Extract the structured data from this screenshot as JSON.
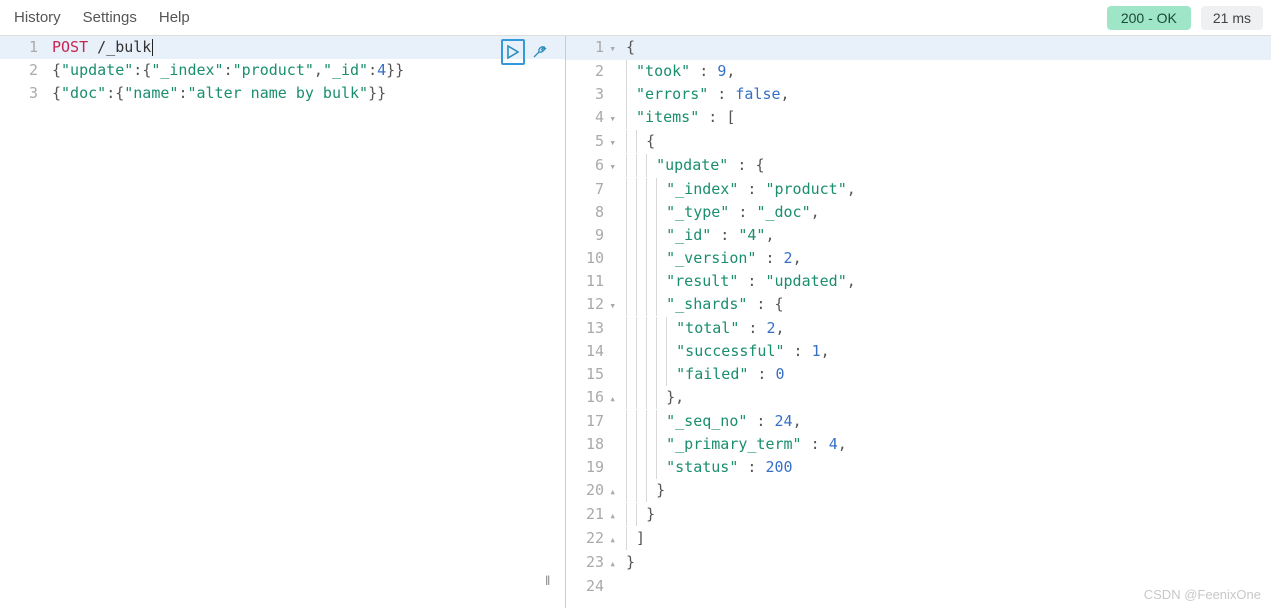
{
  "menu": {
    "history": "History",
    "settings": "Settings",
    "help": "Help"
  },
  "status": {
    "label": "200 - OK"
  },
  "time": {
    "label": "21 ms"
  },
  "watermark": "CSDN @FeenixOne",
  "request": {
    "lines": [
      {
        "n": 1,
        "method": "POST",
        "path": "/_bulk",
        "highlight": true,
        "cursor": true
      },
      {
        "n": 2,
        "raw": [
          [
            "{",
            "punc"
          ],
          [
            "\"update\"",
            "key"
          ],
          [
            ":",
            "punc"
          ],
          [
            "{",
            "punc"
          ],
          [
            "\"_index\"",
            "key"
          ],
          [
            ":",
            "punc"
          ],
          [
            "\"product\"",
            "str"
          ],
          [
            ",",
            "punc"
          ],
          [
            "\"_id\"",
            "key"
          ],
          [
            ":",
            "punc"
          ],
          [
            "4",
            "num"
          ],
          [
            "}}",
            "punc"
          ]
        ]
      },
      {
        "n": 3,
        "raw": [
          [
            "{",
            "punc"
          ],
          [
            "\"doc\"",
            "key"
          ],
          [
            ":",
            "punc"
          ],
          [
            "{",
            "punc"
          ],
          [
            "\"name\"",
            "key"
          ],
          [
            ":",
            "punc"
          ],
          [
            "\"alter name by bulk\"",
            "str"
          ],
          [
            "}}",
            "punc"
          ]
        ]
      }
    ]
  },
  "response": {
    "lines": [
      {
        "n": 1,
        "indent": 0,
        "fold": "▾",
        "highlight": true,
        "raw": [
          [
            "{",
            "punc"
          ]
        ]
      },
      {
        "n": 2,
        "indent": 1,
        "raw": [
          [
            "\"took\"",
            "key"
          ],
          [
            " : ",
            "punc"
          ],
          [
            "9",
            "num"
          ],
          [
            ",",
            "punc"
          ]
        ]
      },
      {
        "n": 3,
        "indent": 1,
        "raw": [
          [
            "\"errors\"",
            "key"
          ],
          [
            " : ",
            "punc"
          ],
          [
            "false",
            "bool"
          ],
          [
            ",",
            "punc"
          ]
        ]
      },
      {
        "n": 4,
        "indent": 1,
        "fold": "▾",
        "raw": [
          [
            "\"items\"",
            "key"
          ],
          [
            " : ",
            "punc"
          ],
          [
            "[",
            "punc"
          ]
        ]
      },
      {
        "n": 5,
        "indent": 2,
        "fold": "▾",
        "raw": [
          [
            "{",
            "punc"
          ]
        ]
      },
      {
        "n": 6,
        "indent": 3,
        "fold": "▾",
        "raw": [
          [
            "\"update\"",
            "key"
          ],
          [
            " : ",
            "punc"
          ],
          [
            "{",
            "punc"
          ]
        ]
      },
      {
        "n": 7,
        "indent": 4,
        "raw": [
          [
            "\"_index\"",
            "key"
          ],
          [
            " : ",
            "punc"
          ],
          [
            "\"product\"",
            "str"
          ],
          [
            ",",
            "punc"
          ]
        ]
      },
      {
        "n": 8,
        "indent": 4,
        "raw": [
          [
            "\"_type\"",
            "key"
          ],
          [
            " : ",
            "punc"
          ],
          [
            "\"_doc\"",
            "str"
          ],
          [
            ",",
            "punc"
          ]
        ]
      },
      {
        "n": 9,
        "indent": 4,
        "raw": [
          [
            "\"_id\"",
            "key"
          ],
          [
            " : ",
            "punc"
          ],
          [
            "\"4\"",
            "str"
          ],
          [
            ",",
            "punc"
          ]
        ]
      },
      {
        "n": 10,
        "indent": 4,
        "raw": [
          [
            "\"_version\"",
            "key"
          ],
          [
            " : ",
            "punc"
          ],
          [
            "2",
            "num"
          ],
          [
            ",",
            "punc"
          ]
        ]
      },
      {
        "n": 11,
        "indent": 4,
        "raw": [
          [
            "\"result\"",
            "key"
          ],
          [
            " : ",
            "punc"
          ],
          [
            "\"updated\"",
            "str"
          ],
          [
            ",",
            "punc"
          ]
        ]
      },
      {
        "n": 12,
        "indent": 4,
        "fold": "▾",
        "raw": [
          [
            "\"_shards\"",
            "key"
          ],
          [
            " : ",
            "punc"
          ],
          [
            "{",
            "punc"
          ]
        ]
      },
      {
        "n": 13,
        "indent": 5,
        "raw": [
          [
            "\"total\"",
            "key"
          ],
          [
            " : ",
            "punc"
          ],
          [
            "2",
            "num"
          ],
          [
            ",",
            "punc"
          ]
        ]
      },
      {
        "n": 14,
        "indent": 5,
        "raw": [
          [
            "\"successful\"",
            "key"
          ],
          [
            " : ",
            "punc"
          ],
          [
            "1",
            "num"
          ],
          [
            ",",
            "punc"
          ]
        ]
      },
      {
        "n": 15,
        "indent": 5,
        "raw": [
          [
            "\"failed\"",
            "key"
          ],
          [
            " : ",
            "punc"
          ],
          [
            "0",
            "num"
          ]
        ]
      },
      {
        "n": 16,
        "indent": 4,
        "fold": "▴",
        "raw": [
          [
            "},",
            "punc"
          ]
        ]
      },
      {
        "n": 17,
        "indent": 4,
        "raw": [
          [
            "\"_seq_no\"",
            "key"
          ],
          [
            " : ",
            "punc"
          ],
          [
            "24",
            "num"
          ],
          [
            ",",
            "punc"
          ]
        ]
      },
      {
        "n": 18,
        "indent": 4,
        "raw": [
          [
            "\"_primary_term\"",
            "key"
          ],
          [
            " : ",
            "punc"
          ],
          [
            "4",
            "num"
          ],
          [
            ",",
            "punc"
          ]
        ]
      },
      {
        "n": 19,
        "indent": 4,
        "raw": [
          [
            "\"status\"",
            "key"
          ],
          [
            " : ",
            "punc"
          ],
          [
            "200",
            "num"
          ]
        ]
      },
      {
        "n": 20,
        "indent": 3,
        "fold": "▴",
        "raw": [
          [
            "}",
            "punc"
          ]
        ]
      },
      {
        "n": 21,
        "indent": 2,
        "fold": "▴",
        "raw": [
          [
            "}",
            "punc"
          ]
        ]
      },
      {
        "n": 22,
        "indent": 1,
        "fold": "▴",
        "raw": [
          [
            "]",
            "punc"
          ]
        ]
      },
      {
        "n": 23,
        "indent": 0,
        "fold": "▴",
        "raw": [
          [
            "}",
            "punc"
          ]
        ]
      },
      {
        "n": 24,
        "indent": 0,
        "raw": []
      }
    ]
  }
}
